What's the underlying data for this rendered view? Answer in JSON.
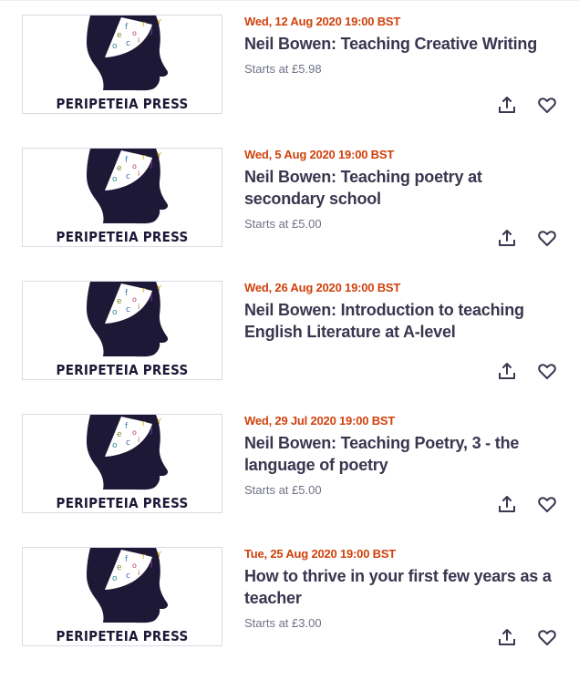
{
  "brand_text": "PERIPETEIA PRESS",
  "colors": {
    "date": "#d1410c",
    "title": "#39364f",
    "muted": "#6f7287",
    "logo": "#1c1836"
  },
  "events": [
    {
      "date": "Wed, 12 Aug 2020 19:00 BST",
      "title": "Neil Bowen: Teaching Creative Writing",
      "price": "Starts at £5.98",
      "image_alt": "PERIPETEIA PRESS"
    },
    {
      "date": "Wed, 5 Aug 2020 19:00 BST",
      "title": "Neil Bowen: Teaching poetry at secondary school",
      "price": "Starts at £5.00",
      "image_alt": "PERIPETEIA PRESS"
    },
    {
      "date": "Wed, 26 Aug 2020 19:00 BST",
      "title": "Neil Bowen: Introduction to teaching English Literature at A-level",
      "price": "",
      "image_alt": "PERIPETEIA PRESS"
    },
    {
      "date": "Wed, 29 Jul 2020 19:00 BST",
      "title": "Neil Bowen: Teaching Poetry, 3 - the language of poetry",
      "price": "Starts at £5.00",
      "image_alt": "PERIPETEIA PRESS"
    },
    {
      "date": "Tue, 25 Aug 2020 19:00 BST",
      "title": "How to thrive in your first few years as a teacher",
      "price": "Starts at £3.00",
      "image_alt": "PERIPETEIA PRESS"
    }
  ],
  "icons": {
    "share": "share-icon",
    "save": "heart-icon"
  }
}
